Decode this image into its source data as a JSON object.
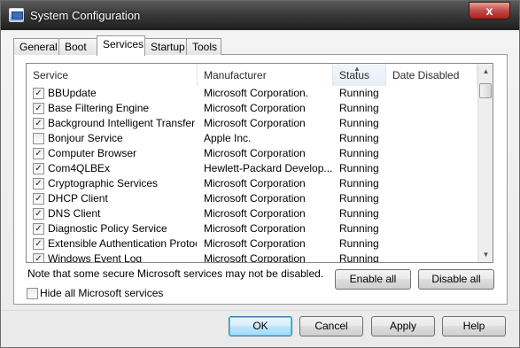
{
  "window": {
    "title": "System Configuration",
    "close_label": "x"
  },
  "tabs": [
    {
      "label": "General"
    },
    {
      "label": "Boot"
    },
    {
      "label": "Services"
    },
    {
      "label": "Startup"
    },
    {
      "label": "Tools"
    }
  ],
  "services_list": {
    "columns": {
      "service": "Service",
      "manufacturer": "Manufacturer",
      "status": "Status",
      "date_disabled": "Date Disabled"
    },
    "sorted_column": "Status",
    "rows": [
      {
        "checked": true,
        "service": "BBUpdate",
        "manufacturer": "Microsoft Corporation.",
        "status": "Running",
        "date_disabled": ""
      },
      {
        "checked": true,
        "service": "Base Filtering Engine",
        "manufacturer": "Microsoft Corporation",
        "status": "Running",
        "date_disabled": ""
      },
      {
        "checked": true,
        "service": "Background Intelligent Transfer ...",
        "manufacturer": "Microsoft Corporation",
        "status": "Running",
        "date_disabled": ""
      },
      {
        "checked": false,
        "service": "Bonjour Service",
        "manufacturer": "Apple Inc.",
        "status": "Running",
        "date_disabled": ""
      },
      {
        "checked": true,
        "service": "Computer Browser",
        "manufacturer": "Microsoft Corporation",
        "status": "Running",
        "date_disabled": ""
      },
      {
        "checked": true,
        "service": "Com4QLBEx",
        "manufacturer": "Hewlett-Packard Develop...",
        "status": "Running",
        "date_disabled": ""
      },
      {
        "checked": true,
        "service": "Cryptographic Services",
        "manufacturer": "Microsoft Corporation",
        "status": "Running",
        "date_disabled": ""
      },
      {
        "checked": true,
        "service": "DHCP Client",
        "manufacturer": "Microsoft Corporation",
        "status": "Running",
        "date_disabled": ""
      },
      {
        "checked": true,
        "service": "DNS Client",
        "manufacturer": "Microsoft Corporation",
        "status": "Running",
        "date_disabled": ""
      },
      {
        "checked": true,
        "service": "Diagnostic Policy Service",
        "manufacturer": "Microsoft Corporation",
        "status": "Running",
        "date_disabled": ""
      },
      {
        "checked": true,
        "service": "Extensible Authentication Protocol",
        "manufacturer": "Microsoft Corporation",
        "status": "Running",
        "date_disabled": ""
      },
      {
        "checked": true,
        "service": "Windows Event Log",
        "manufacturer": "Microsoft Corporation",
        "status": "Running",
        "date_disabled": ""
      }
    ]
  },
  "note": "Note that some secure Microsoft services may not be disabled.",
  "buttons": {
    "enable_all": "Enable all",
    "disable_all": "Disable all",
    "ok": "OK",
    "cancel": "Cancel",
    "apply": "Apply",
    "help": "Help"
  },
  "hide_ms": {
    "label": "Hide all Microsoft services",
    "checked": false
  },
  "icons": {
    "app": "system-config-icon",
    "check": "checkmark-icon",
    "sort": "sort-up-icon"
  }
}
